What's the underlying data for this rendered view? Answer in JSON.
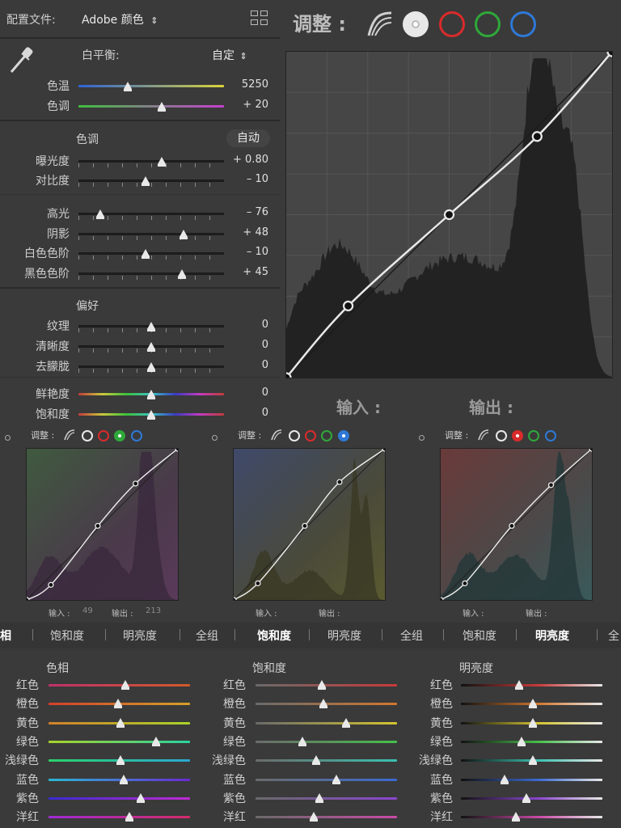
{
  "profile": {
    "label": "配置文件:",
    "value": "Adobe 颜色",
    "arrow": "⇕"
  },
  "white_balance": {
    "label": "白平衡:",
    "value": "自定",
    "arrow": "⇕"
  },
  "basic": {
    "temp": {
      "label": "色温",
      "value": "5250",
      "level": 0.34
    },
    "tint": {
      "label": "色调",
      "value": "+ 20",
      "level": 0.57
    },
    "tone_title": "色调",
    "auto": "自动",
    "exposure": {
      "label": "曝光度",
      "value": "+ 0.80",
      "level": 0.57
    },
    "contrast": {
      "label": "对比度",
      "value": "– 10",
      "level": 0.46
    },
    "highlights": {
      "label": "高光",
      "value": "– 76",
      "level": 0.15
    },
    "shadows": {
      "label": "阴影",
      "value": "+ 48",
      "level": 0.72
    },
    "whites": {
      "label": "白色色阶",
      "value": "– 10",
      "level": 0.46
    },
    "blacks": {
      "label": "黑色色阶",
      "value": "+ 45",
      "level": 0.71
    },
    "presence_title": "偏好",
    "texture": {
      "label": "纹理",
      "value": "0",
      "level": 0.5
    },
    "clarity": {
      "label": "清晰度",
      "value": "0",
      "level": 0.5
    },
    "dehaze": {
      "label": "去朦胧",
      "value": "0",
      "level": 0.5
    },
    "vibrance": {
      "label": "鲜艳度",
      "value": "0",
      "level": 0.5
    },
    "saturation": {
      "label": "饱和度",
      "value": "0",
      "level": 0.5
    }
  },
  "curve": {
    "title": "调整 :",
    "input_label": "输入 :",
    "output_label": "输出 :",
    "channels": [
      "parametric-icon",
      "point-white",
      "red",
      "green",
      "blue"
    ],
    "colors": {
      "red": "#d92b2b",
      "green": "#2fa83a",
      "blue": "#2f78d6",
      "white": "#e8e8e8"
    },
    "points": [
      [
        0,
        0
      ],
      [
        0.19,
        0.22
      ],
      [
        0.5,
        0.5
      ],
      [
        0.77,
        0.74
      ],
      [
        1,
        1
      ]
    ]
  },
  "mini": [
    {
      "title": "调整 :",
      "active": "green",
      "input_label": "输入 :",
      "input_value": "49",
      "output_label": "输出 :",
      "output_value": "213",
      "points": [
        [
          0,
          0
        ],
        [
          0.16,
          0.1
        ],
        [
          0.47,
          0.49
        ],
        [
          0.72,
          0.77
        ],
        [
          1,
          1
        ]
      ]
    },
    {
      "title": "调整 :",
      "active": "blue",
      "input_label": "输入 :",
      "input_value": "",
      "output_label": "输出 :",
      "output_value": "",
      "points": [
        [
          0,
          0
        ],
        [
          0.16,
          0.11
        ],
        [
          0.47,
          0.49
        ],
        [
          0.7,
          0.78
        ],
        [
          1,
          1
        ]
      ]
    },
    {
      "title": "调整 :",
      "active": "red",
      "input_label": "输入 :",
      "input_value": "",
      "output_label": "输出 :",
      "output_value": "",
      "points": [
        [
          0,
          0
        ],
        [
          0.16,
          0.11
        ],
        [
          0.47,
          0.49
        ],
        [
          0.73,
          0.76
        ],
        [
          1,
          1
        ]
      ]
    }
  ],
  "tabs": [
    {
      "label": "相",
      "active": true
    },
    {
      "label": "饱和度",
      "active": false
    },
    {
      "label": "明亮度",
      "active": false
    },
    {
      "label": "全组",
      "active": false
    },
    {
      "label": "饱和度",
      "active": true
    },
    {
      "label": "明亮度",
      "active": false
    },
    {
      "label": "全组",
      "active": false
    },
    {
      "label": "饱和度",
      "active": false
    },
    {
      "label": "明亮度",
      "active": true
    },
    {
      "label": "全",
      "active": false
    }
  ],
  "hsl": {
    "columns": [
      {
        "title": "色相",
        "levels": [
          0.54,
          0.49,
          0.51,
          0.76,
          0.51,
          0.53,
          0.65,
          0.57
        ]
      },
      {
        "title": "饱和度",
        "levels": [
          0.47,
          0.48,
          0.64,
          0.33,
          0.43,
          0.57,
          0.45,
          0.41
        ]
      },
      {
        "title": "明亮度",
        "levels": [
          0.41,
          0.51,
          0.51,
          0.43,
          0.51,
          0.31,
          0.46,
          0.39
        ]
      }
    ],
    "labels": [
      "红色",
      "橙色",
      "黄色",
      "绿色",
      "浅绿色",
      "蓝色",
      "紫色",
      "洋红"
    ]
  }
}
